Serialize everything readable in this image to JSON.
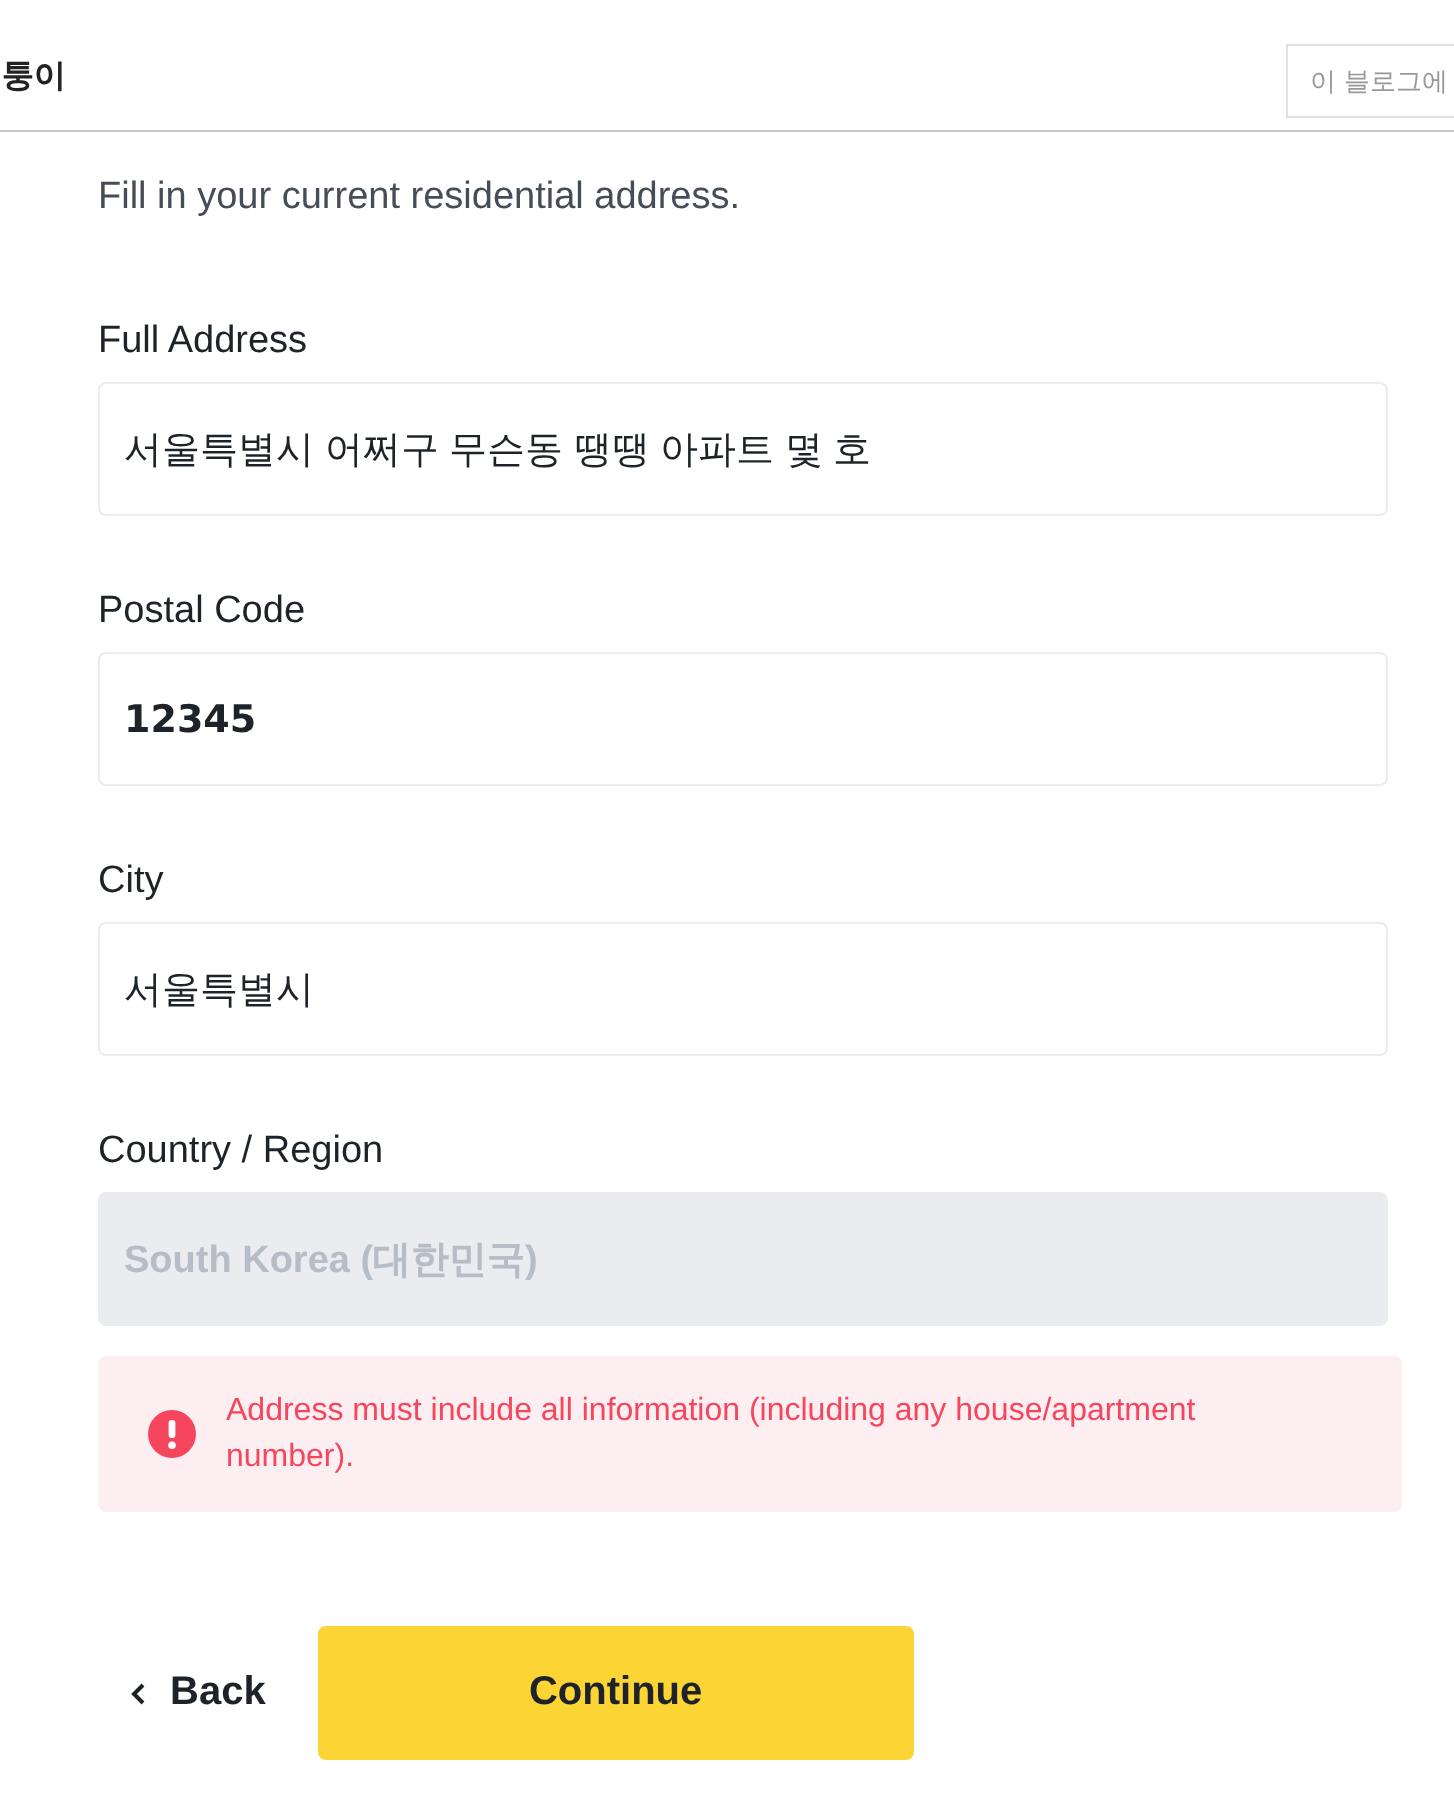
{
  "header": {
    "blog_title": "퉁이",
    "search": {
      "placeholder": "이 블로그에"
    }
  },
  "form": {
    "intro": "Fill in your current residential address.",
    "fields": [
      {
        "label": "Full Address",
        "value": "서울특별시 어쩌구 무슨동 땡땡 아파트 몇 호",
        "kind": "text",
        "disabled": false
      },
      {
        "label": "Postal Code",
        "value": "12345",
        "kind": "number",
        "disabled": false
      },
      {
        "label": "City",
        "value": "서울특별시",
        "kind": "text",
        "disabled": false
      },
      {
        "label": "Country / Region",
        "value": "South Korea (대한민국)",
        "kind": "text",
        "disabled": true
      }
    ],
    "error": "Address must include all information (including any house/apartment number).",
    "buttons": [
      {
        "label": "Back",
        "kind": "back"
      },
      {
        "label": "Continue",
        "kind": "primary"
      }
    ]
  }
}
